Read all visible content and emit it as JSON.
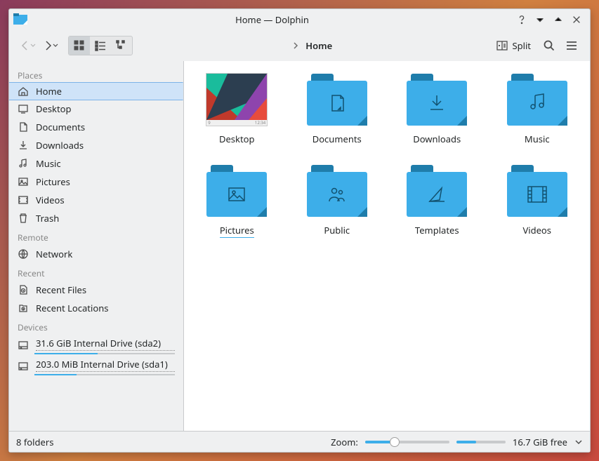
{
  "window": {
    "title": "Home — Dolphin"
  },
  "toolbar": {
    "split_label": "Split"
  },
  "breadcrumb": {
    "current": "Home"
  },
  "sidebar": {
    "sections": {
      "places": "Places",
      "remote": "Remote",
      "recent": "Recent",
      "devices": "Devices"
    },
    "places": [
      {
        "label": "Home",
        "icon": "home",
        "selected": true
      },
      {
        "label": "Desktop",
        "icon": "desktop"
      },
      {
        "label": "Documents",
        "icon": "document"
      },
      {
        "label": "Downloads",
        "icon": "download"
      },
      {
        "label": "Music",
        "icon": "music"
      },
      {
        "label": "Pictures",
        "icon": "picture"
      },
      {
        "label": "Videos",
        "icon": "video"
      },
      {
        "label": "Trash",
        "icon": "trash"
      }
    ],
    "remote": [
      {
        "label": "Network",
        "icon": "network"
      }
    ],
    "recent": [
      {
        "label": "Recent Files",
        "icon": "recent-files"
      },
      {
        "label": "Recent Locations",
        "icon": "recent-locations"
      }
    ],
    "devices": [
      {
        "label": "31.6 GiB Internal Drive (sda2)",
        "usage_pct": 45
      },
      {
        "label": "203.0 MiB Internal Drive (sda1)",
        "usage_pct": 30
      }
    ]
  },
  "content": {
    "items": [
      {
        "name": "Desktop",
        "kind": "thumb"
      },
      {
        "name": "Documents",
        "kind": "folder",
        "icon": "document"
      },
      {
        "name": "Downloads",
        "kind": "folder",
        "icon": "download"
      },
      {
        "name": "Music",
        "kind": "folder",
        "icon": "music"
      },
      {
        "name": "Pictures",
        "kind": "folder",
        "icon": "picture",
        "highlight": true
      },
      {
        "name": "Public",
        "kind": "folder",
        "icon": "public"
      },
      {
        "name": "Templates",
        "kind": "folder",
        "icon": "template"
      },
      {
        "name": "Videos",
        "kind": "folder",
        "icon": "video"
      }
    ]
  },
  "status": {
    "summary": "8 folders",
    "zoom_label": "Zoom:",
    "zoom_pct": 35,
    "space_pct": 40,
    "free": "16.7 GiB free"
  }
}
